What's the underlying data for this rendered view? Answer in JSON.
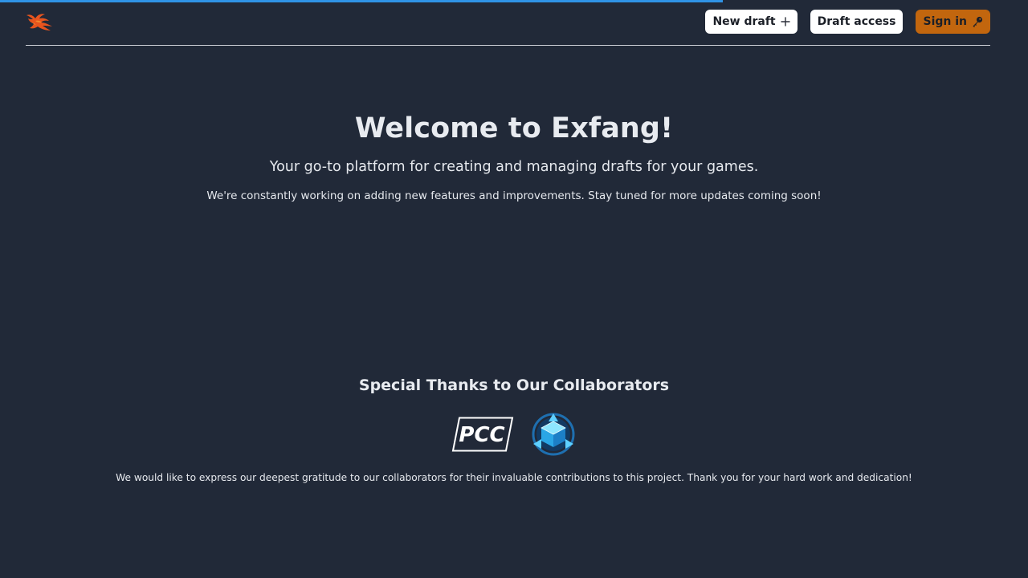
{
  "progress": {
    "value": 0.703,
    "color": "#2f93e6"
  },
  "header": {
    "logo_icon": "phoenix-logo-icon",
    "buttons": {
      "new_draft": {
        "label": "New draft",
        "icon": "plus-icon"
      },
      "draft_access": {
        "label": "Draft access"
      },
      "sign_in": {
        "label": "Sign in",
        "icon": "key-icon"
      }
    }
  },
  "hero": {
    "title": "Welcome to Exfang!",
    "subtitle": "Your go-to platform for creating and managing drafts for your games.",
    "note": "We're constantly working on adding new features and improvements. Stay tuned for more updates coming soon!"
  },
  "collaborators": {
    "heading": "Special Thanks to Our Collaborators",
    "logos": [
      {
        "name": "PCC",
        "icon": "pcc-logo"
      },
      {
        "name": "",
        "icon": "blue-cube-logo"
      }
    ],
    "gratitude": "We would like to express our deepest gratitude to our collaborators for their invaluable contributions to this project. Thank you for your hard work and dedication!"
  },
  "colors": {
    "background": "#212938",
    "accent_orange": "#c2660e",
    "accent_blue": "#2f93e6"
  }
}
